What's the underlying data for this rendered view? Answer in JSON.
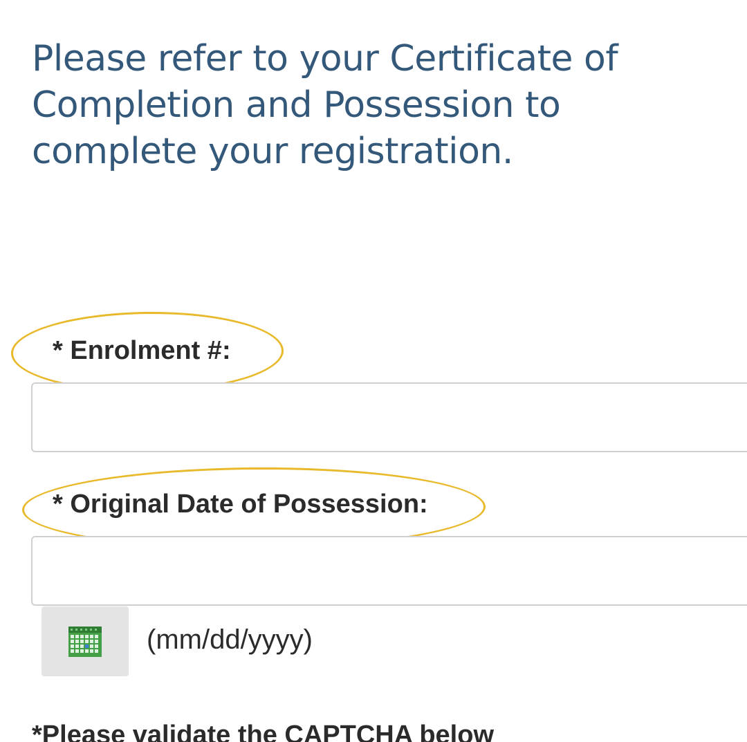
{
  "intro": {
    "text": "Please refer to your Certificate of Completion and Possession to complete your registration."
  },
  "form": {
    "enrolment": {
      "label": "* Enrolment #:",
      "value": "",
      "placeholder": ""
    },
    "possession_date": {
      "label": "* Original Date of Possession:",
      "value": "",
      "placeholder": "",
      "format_hint": "(mm/dd/yyyy)"
    },
    "calendar_button": {
      "icon": "calendar-icon"
    },
    "captcha_note": "*Please validate the CAPTCHA below"
  },
  "colors": {
    "intro_text": "#33587a",
    "label_text": "#2b2b2b",
    "highlight": "#e8b92b",
    "input_border": "#cfcfcf",
    "calendar_button_bg": "#e4e4e4",
    "calendar_icon": "#4caf50"
  }
}
